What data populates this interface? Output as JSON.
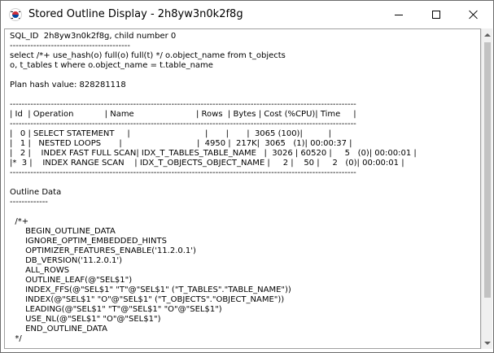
{
  "window": {
    "title": "Stored Outline Display - 2h8yw3n0k2f8g"
  },
  "content": {
    "lines": [
      "SQL_ID  2h8yw3n0k2f8g, child number 0",
      "-----------------------------------------",
      "select /*+ use_hash(o) full(o) full(t) */ o.object_name from t_objects",
      "o, t_tables t where o.object_name = t.table_name",
      "",
      "Plan hash value: 828281118",
      "",
      "----------------------------------------------------------------------------------------------------------------------",
      "| Id  | Operation            | Name                        | Rows  | Bytes | Cost (%CPU)| Time     |",
      "----------------------------------------------------------------------------------------------------------------------",
      "|   0 | SELECT STATEMENT     |                             |       |       |  3065 (100)|          |",
      "|   1 |   NESTED LOOPS       |                             |  4950 |  217K|  3065   (1)| 00:00:37 |",
      "|   2 |    INDEX FAST FULL SCAN| IDX_T_TABLES_TABLE_NAME   |  3026 | 60520 |     5   (0)| 00:00:01 |",
      "|*  3 |    INDEX RANGE SCAN    | IDX_T_OBJECTS_OBJECT_NAME |     2 |    50 |     2   (0)| 00:00:01 |",
      "----------------------------------------------------------------------------------------------------------------------",
      "",
      "Outline Data",
      "-------------",
      "",
      "  /*+",
      "      BEGIN_OUTLINE_DATA",
      "      IGNORE_OPTIM_EMBEDDED_HINTS",
      "      OPTIMIZER_FEATURES_ENABLE('11.2.0.1')",
      "      DB_VERSION('11.2.0.1')",
      "      ALL_ROWS",
      "      OUTLINE_LEAF(@\"SEL$1\")",
      "      INDEX_FFS(@\"SEL$1\" \"T\"@\"SEL$1\" (\"T_TABLES\".\"TABLE_NAME\"))",
      "      INDEX(@\"SEL$1\" \"O\"@\"SEL$1\" (\"T_OBJECTS\".\"OBJECT_NAME\"))",
      "      LEADING(@\"SEL$1\" \"T\"@\"SEL$1\" \"O\"@\"SEL$1\")",
      "      USE_NL(@\"SEL$1\" \"O\"@\"SEL$1\")",
      "      END_OUTLINE_DATA",
      "  */"
    ]
  }
}
